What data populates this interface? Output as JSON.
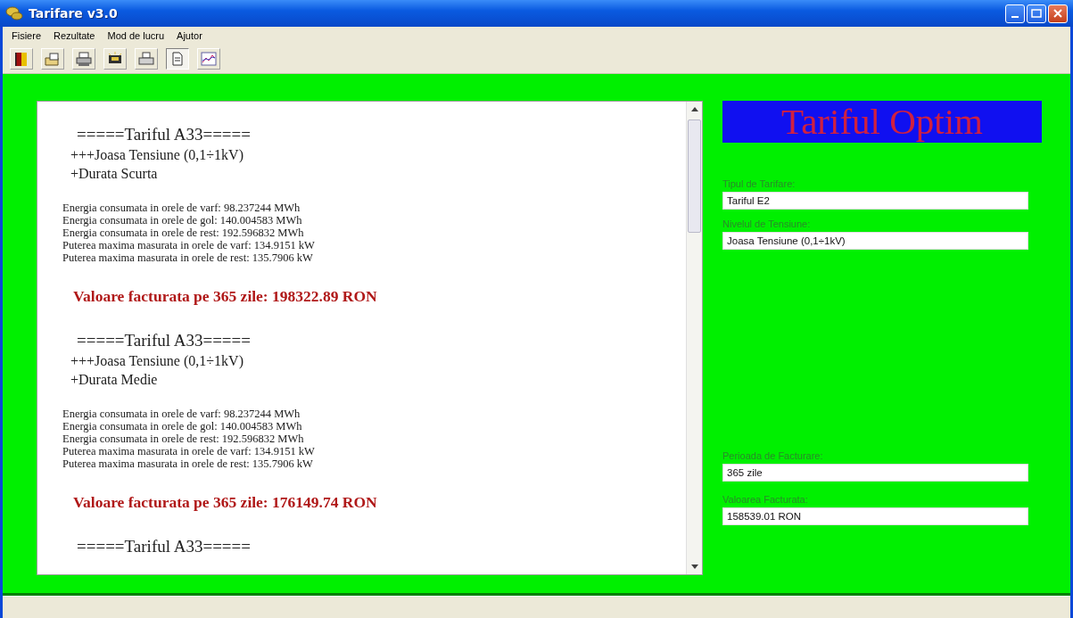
{
  "window": {
    "title": "Tarifare v3.0"
  },
  "menu": [
    "Fisiere",
    "Rezultate",
    "Mod de lucru",
    "Ajutor"
  ],
  "toolbar": [
    {
      "kind": "exit",
      "pressed": false
    },
    {
      "kind": "open",
      "pressed": false
    },
    {
      "kind": "print",
      "pressed": false
    },
    {
      "kind": "device",
      "pressed": false
    },
    {
      "kind": "printer",
      "pressed": false
    },
    {
      "kind": "document",
      "pressed": true
    },
    {
      "kind": "chart",
      "pressed": false
    }
  ],
  "report": {
    "sections": [
      {
        "header": "=====Tariful A33=====",
        "voltage": "+++Joasa Tensiune (0,1÷1kV)",
        "duration": "+Durata Scurta",
        "lines": [
          "Energia consumata in orele de varf: 98.237244 MWh",
          "Energia consumata in orele de gol: 140.004583 MWh",
          "Energia consumata in orele de rest: 192.596832 MWh",
          "Puterea maxima masurata in orele de varf: 134.9151 kW",
          "Puterea maxima masurata in orele de rest: 135.7906 kW"
        ],
        "total": "Valoare facturata pe 365 zile: 198322.89 RON"
      },
      {
        "header": "=====Tariful A33=====",
        "voltage": "+++Joasa Tensiune (0,1÷1kV)",
        "duration": "+Durata Medie",
        "lines": [
          "Energia consumata in orele de varf: 98.237244 MWh",
          "Energia consumata in orele de gol: 140.004583 MWh",
          "Energia consumata in orele de rest: 192.596832 MWh",
          "Puterea maxima masurata in orele de varf: 134.9151 kW",
          "Puterea maxima masurata in orele de rest: 135.7906 kW"
        ],
        "total": "Valoare facturata pe 365 zile: 176149.74 RON"
      },
      {
        "header": "=====Tariful A33====="
      }
    ]
  },
  "optim": {
    "title": "Tariful Optim",
    "fields": [
      {
        "label": "Tipul de Tarifare:",
        "value": "Tariful E2"
      },
      {
        "label": "Nivelul de Tensiune:",
        "value": "Joasa Tensiune (0,1÷1kV)"
      },
      {
        "label": "Perioada de Facturare:",
        "value": "365 zile"
      },
      {
        "label": "Valoarea Facturata:",
        "value": "158539.01 RON"
      }
    ]
  }
}
